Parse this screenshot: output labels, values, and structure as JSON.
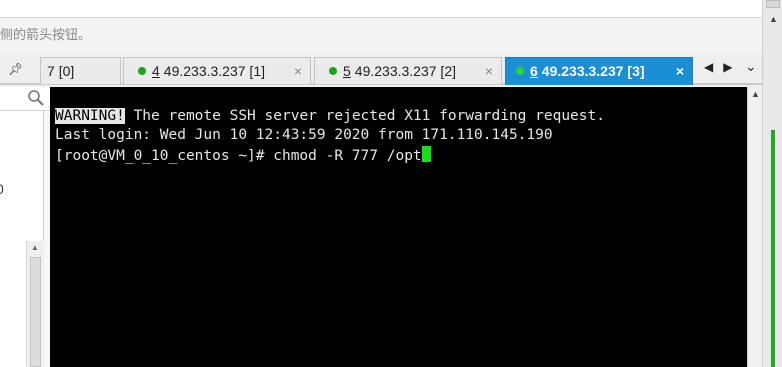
{
  "hint": {
    "text": "侧的箭头按钮。"
  },
  "tabbar": {
    "pin_icon": "pin-icon",
    "tabs": [
      {
        "num": "7",
        "title": "[0]",
        "connected": false,
        "active": false
      },
      {
        "num": "4",
        "title": "49.233.3.237 [1]",
        "connected": true,
        "active": false
      },
      {
        "num": "5",
        "title": "49.233.3.237 [2]",
        "connected": true,
        "active": false
      },
      {
        "num": "6",
        "title": "49.233.3.237 [3]",
        "connected": true,
        "active": true
      }
    ],
    "close_glyph": "×",
    "nav_left": "◀",
    "nav_right": "▶",
    "menu_glyph": "⌄"
  },
  "leftpanel": {
    "value": "0",
    "search_icon": "search-icon"
  },
  "terminal": {
    "warning_tag": "WARNING!",
    "line1_rest": " The remote SSH server rejected X11 forwarding request.",
    "line2": "Last login: Wed Jun 10 12:43:59 2020 from 171.110.145.190",
    "line3": "[root@VM_0_10_centos ~]# chmod -R 777 /opt"
  },
  "colors": {
    "active_tab": "#1a8fd6",
    "status_dot": "#1aa51a",
    "cursor": "#16e016",
    "terminal_bg": "#000000"
  }
}
